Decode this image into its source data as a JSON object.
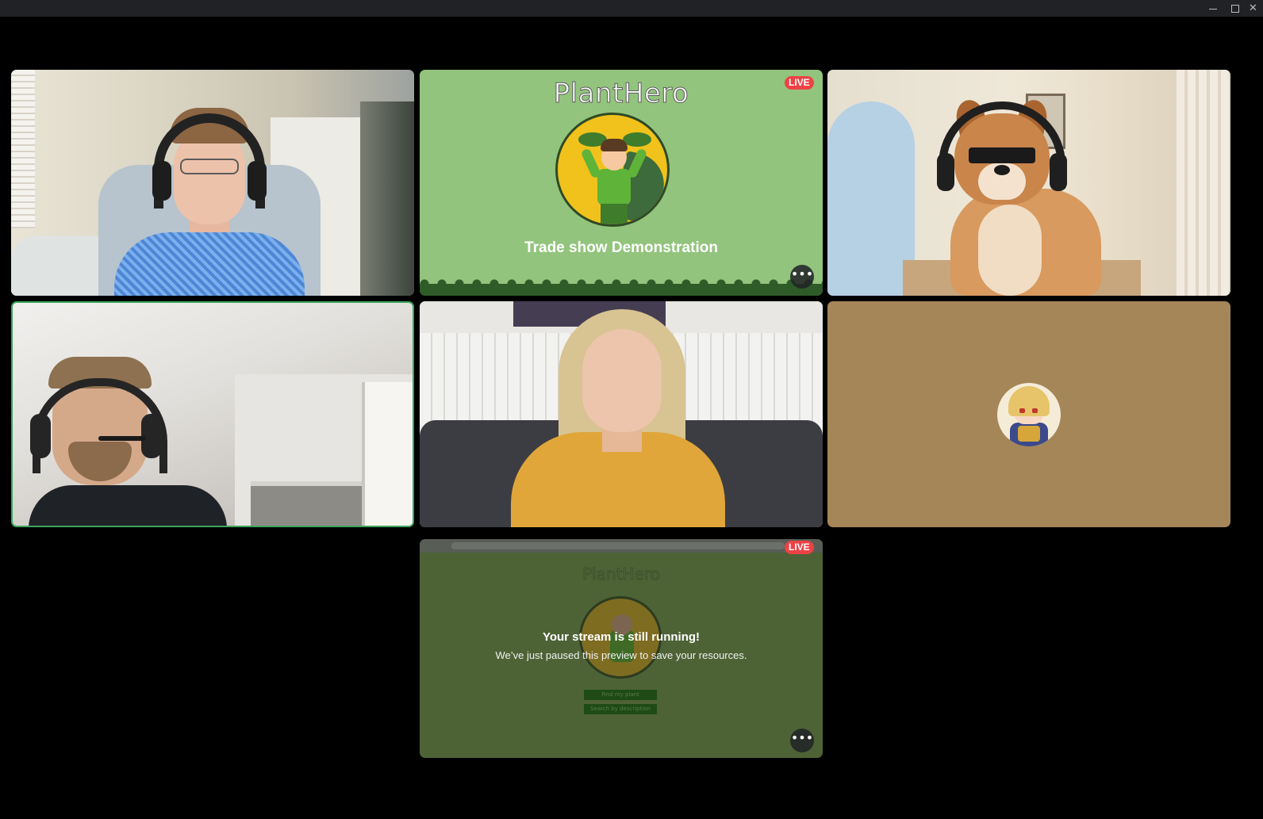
{
  "window": {
    "controls": [
      {
        "name": "minimize",
        "icon": "minimize-icon"
      },
      {
        "name": "maximize",
        "icon": "maximize-icon"
      },
      {
        "name": "close",
        "icon": "close-icon",
        "glyph": "✕"
      }
    ]
  },
  "tiles": {
    "share_main": {
      "slide_title": "PlantHero",
      "slide_subtitle": "Trade show Demonstration",
      "live_badge": "LIVE",
      "more_label": "•••"
    },
    "preview": {
      "live_badge": "LIVE",
      "slide_title": "PlantHero",
      "button1": "Find my plant",
      "button2": "Search by description",
      "message_title": "Your stream is still running!",
      "message_body": "We’ve just paused this preview to save your resources.",
      "more_label": "•••"
    }
  },
  "colors": {
    "live_red": "#ed4245",
    "speaking_green": "#3ba55c",
    "titlebar": "#202225"
  }
}
